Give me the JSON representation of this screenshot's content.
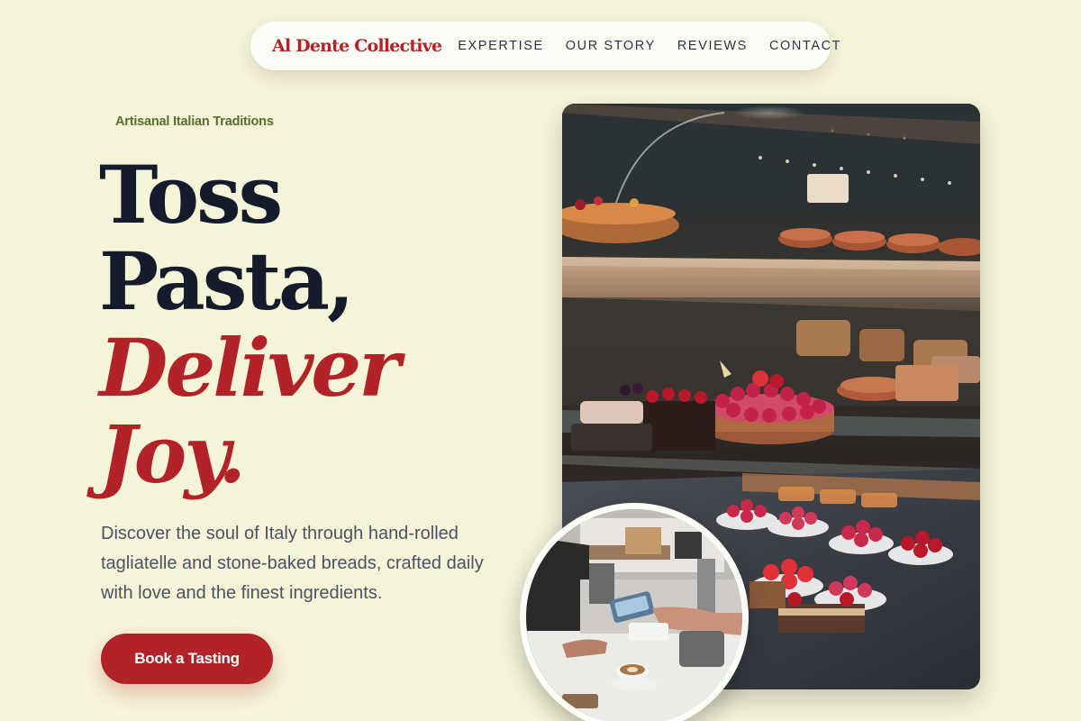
{
  "nav": {
    "brand": "Al Dente Collective",
    "links": [
      "EXPERTISE",
      "OUR STORY",
      "REVIEWS",
      "CONTACT"
    ]
  },
  "hero": {
    "eyebrow": "Artisanal Italian Traditions",
    "headline_line1": "Toss",
    "headline_line2": "Pasta,",
    "headline_line3": "Deliver",
    "headline_line4": "Joy.",
    "description": "Discover the soul of Italy through hand-rolled tagliatelle and stone-baked breads, crafted daily with love and the finest ingredients.",
    "cta_label": "Book a Tasting"
  },
  "colors": {
    "background": "#f5f3d8",
    "accent": "#b22328",
    "heading": "#141b2d",
    "eyebrow": "#5a6b2e"
  }
}
